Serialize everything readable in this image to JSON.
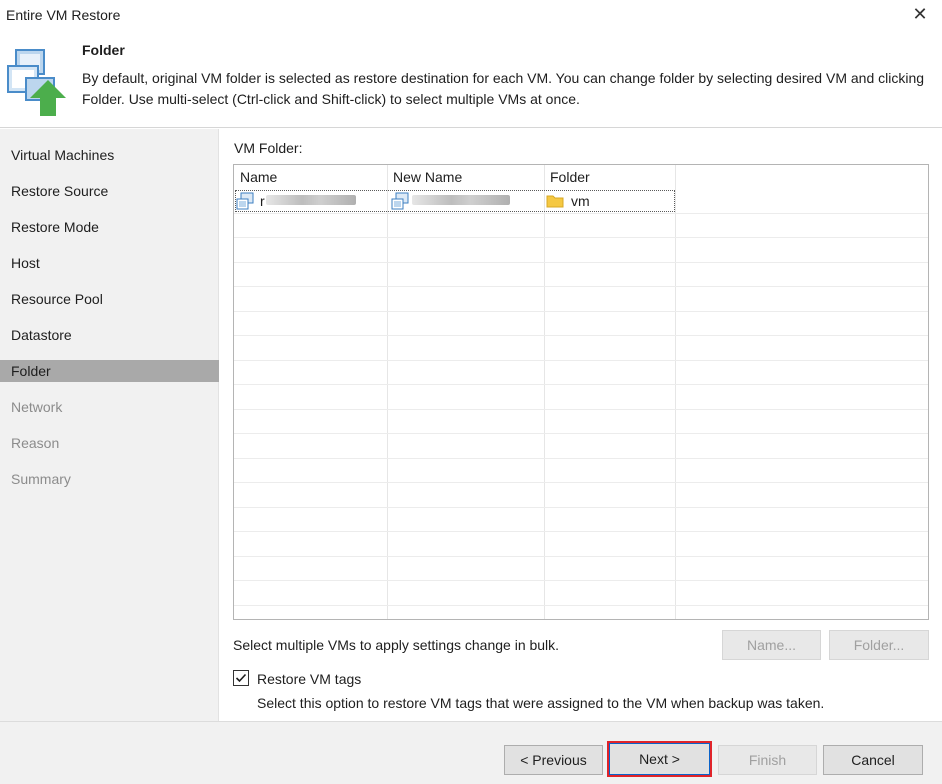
{
  "window": {
    "title": "Entire VM Restore",
    "close_glyph": "✕"
  },
  "header": {
    "title": "Folder",
    "description": "By default, original VM folder is selected as restore destination for each VM. You can change folder by selecting desired VM and clicking Folder. Use multi-select (Ctrl-click and Shift-click) to select multiple VMs at once.",
    "icon": "vm-restore-arrow-icon"
  },
  "steps": [
    {
      "label": "Virtual Machines",
      "state": "normal"
    },
    {
      "label": "Restore Source",
      "state": "normal"
    },
    {
      "label": "Restore Mode",
      "state": "normal"
    },
    {
      "label": "Host",
      "state": "normal"
    },
    {
      "label": "Resource Pool",
      "state": "normal"
    },
    {
      "label": "Datastore",
      "state": "normal"
    },
    {
      "label": "Folder",
      "state": "active"
    },
    {
      "label": "Network",
      "state": "disabled"
    },
    {
      "label": "Reason",
      "state": "disabled"
    },
    {
      "label": "Summary",
      "state": "disabled"
    }
  ],
  "vm_folder": {
    "label": "VM Folder:",
    "columns": [
      "Name",
      "New Name",
      "Folder"
    ],
    "rows": [
      {
        "name": "r",
        "new_name": "",
        "folder": "vm"
      }
    ]
  },
  "hint": "Select multiple VMs to apply settings change in bulk.",
  "buttons": {
    "name": "Name...",
    "folder": "Folder...",
    "previous": "< Previous",
    "next": "Next >",
    "finish": "Finish",
    "cancel": "Cancel"
  },
  "restore_tags": {
    "checked": true,
    "label": "Restore VM tags",
    "description": "Select this option to restore VM tags that were assigned to the VM when backup was taken."
  },
  "colors": {
    "active_step": "#a9a9a9",
    "highlight_border": "#e0242a",
    "folder_yellow": "#f5c842"
  }
}
